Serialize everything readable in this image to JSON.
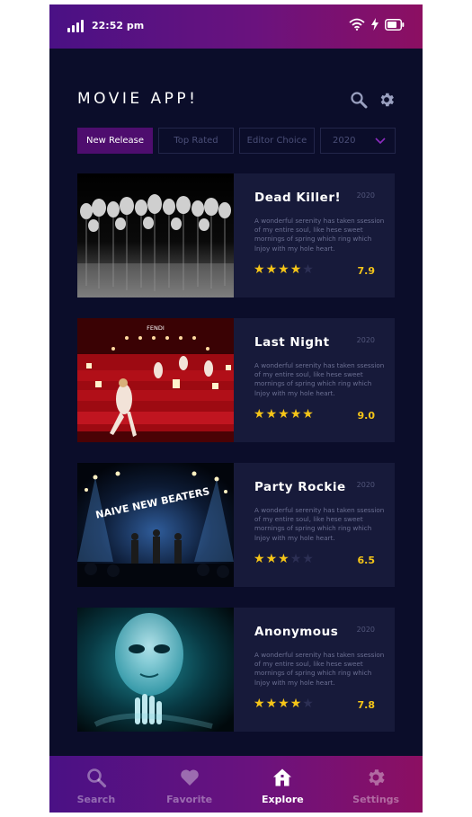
{
  "status_bar": {
    "time": "22:52 pm"
  },
  "header": {
    "title": "MOVIE APP!",
    "search_icon": "search-icon",
    "settings_icon": "gear-icon"
  },
  "filters": {
    "tabs": [
      {
        "label": "New Release",
        "active": true
      },
      {
        "label": "Top Rated",
        "active": false
      },
      {
        "label": "Editor Choice",
        "active": false
      }
    ],
    "year_select": {
      "value": "2020"
    }
  },
  "movies": [
    {
      "title": "Dead Killer!",
      "year": "2020",
      "description": "A wonderful serenity has taken ssession of my entire soul, like hese sweet mornings of spring which ring which lnjoy with my hole heart.",
      "stars": 4,
      "rating": "7.9"
    },
    {
      "title": "Last Night",
      "year": "2020",
      "description": "A wonderful serenity has taken ssession of my entire soul, like hese sweet mornings of spring which ring which lnjoy with my hole heart.",
      "stars": 5,
      "rating": "9.0",
      "poster_sign": "FENDI"
    },
    {
      "title": "Party Rockie",
      "year": "2020",
      "description": "A wonderful serenity has taken ssession of my entire soul, like hese sweet mornings of spring which ring which lnjoy with my hole heart.",
      "stars": 3,
      "rating": "6.5",
      "poster_sign": "NAIVE NEW BEATERS"
    },
    {
      "title": "Anonymous",
      "year": "2020",
      "description": "A wonderful serenity has taken ssession of my entire soul, like hese sweet mornings of spring which ring which lnjoy with my hole heart.",
      "stars": 4,
      "rating": "7.8"
    }
  ],
  "bottom_nav": {
    "items": [
      {
        "label": "Search",
        "icon": "search-icon",
        "active": false
      },
      {
        "label": "Favorite",
        "icon": "heart-icon",
        "active": false
      },
      {
        "label": "Explore",
        "icon": "home-icon",
        "active": true
      },
      {
        "label": "Settings",
        "icon": "gear-icon",
        "active": false
      }
    ]
  },
  "colors": {
    "background": "#0b0d2a",
    "card": "#171a3a",
    "accent": "#4e0d6e",
    "star": "#f5c518",
    "gradient_start": "#4a1185",
    "gradient_end": "#8c0f62"
  }
}
